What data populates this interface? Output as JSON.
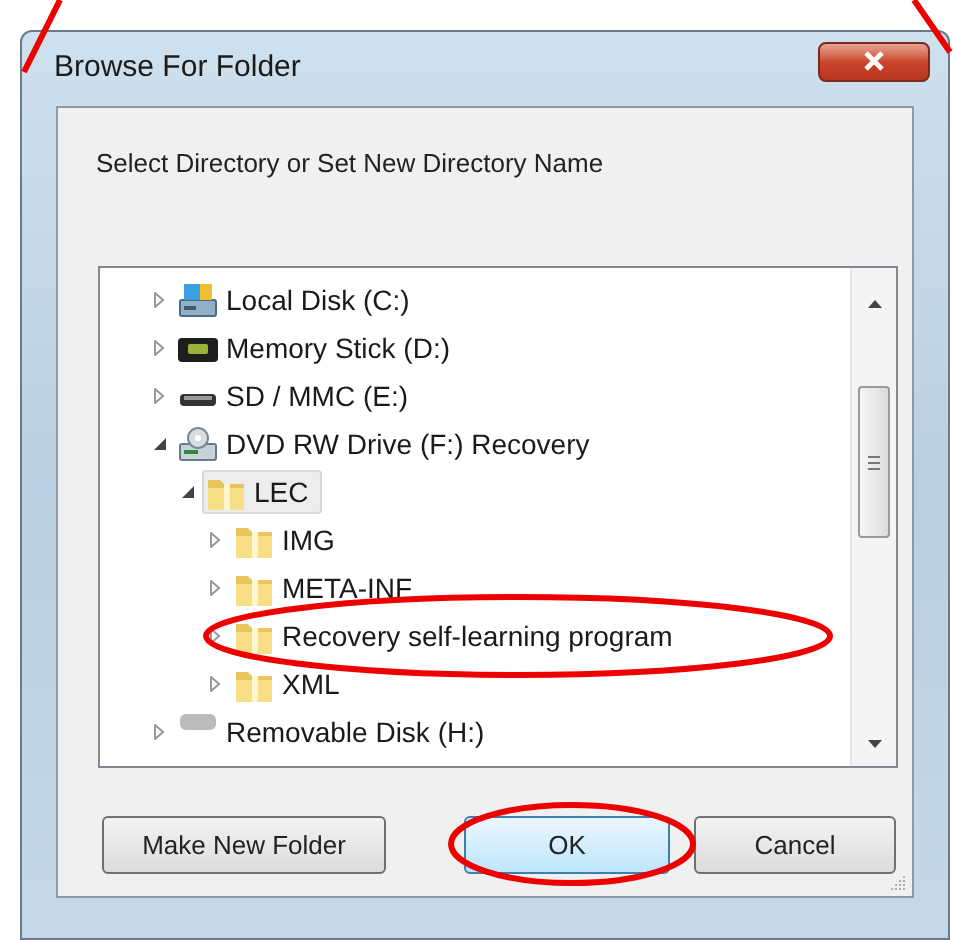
{
  "window": {
    "title": "Browse For Folder"
  },
  "prompt": "Select Directory or Set New Directory Name",
  "tree": [
    {
      "label": "Local Disk (C:)",
      "kind": "local-disk",
      "expanded": false,
      "selected": false
    },
    {
      "label": "Memory Stick (D:)",
      "kind": "memory-stick",
      "expanded": false,
      "selected": false
    },
    {
      "label": "SD / MMC (E:)",
      "kind": "sd-card",
      "expanded": false,
      "selected": false
    },
    {
      "label": "DVD RW Drive (F:) Recovery",
      "kind": "dvd",
      "expanded": true,
      "selected": false,
      "children": [
        {
          "label": "LEC",
          "kind": "folder",
          "expanded": true,
          "selected": true,
          "children": [
            {
              "label": "IMG",
              "kind": "folder",
              "expanded": false,
              "selected": false
            },
            {
              "label": "META-INF",
              "kind": "folder",
              "expanded": false,
              "selected": false
            },
            {
              "label": "Recovery self-learning program",
              "kind": "folder",
              "expanded": false,
              "selected": false
            },
            {
              "label": "XML",
              "kind": "folder",
              "expanded": false,
              "selected": false
            }
          ]
        }
      ]
    },
    {
      "label": "Removable Disk (H:)",
      "kind": "removable",
      "expanded": false,
      "selected": false
    }
  ],
  "buttons": [
    "Make New Folder",
    "OK",
    "Cancel"
  ]
}
